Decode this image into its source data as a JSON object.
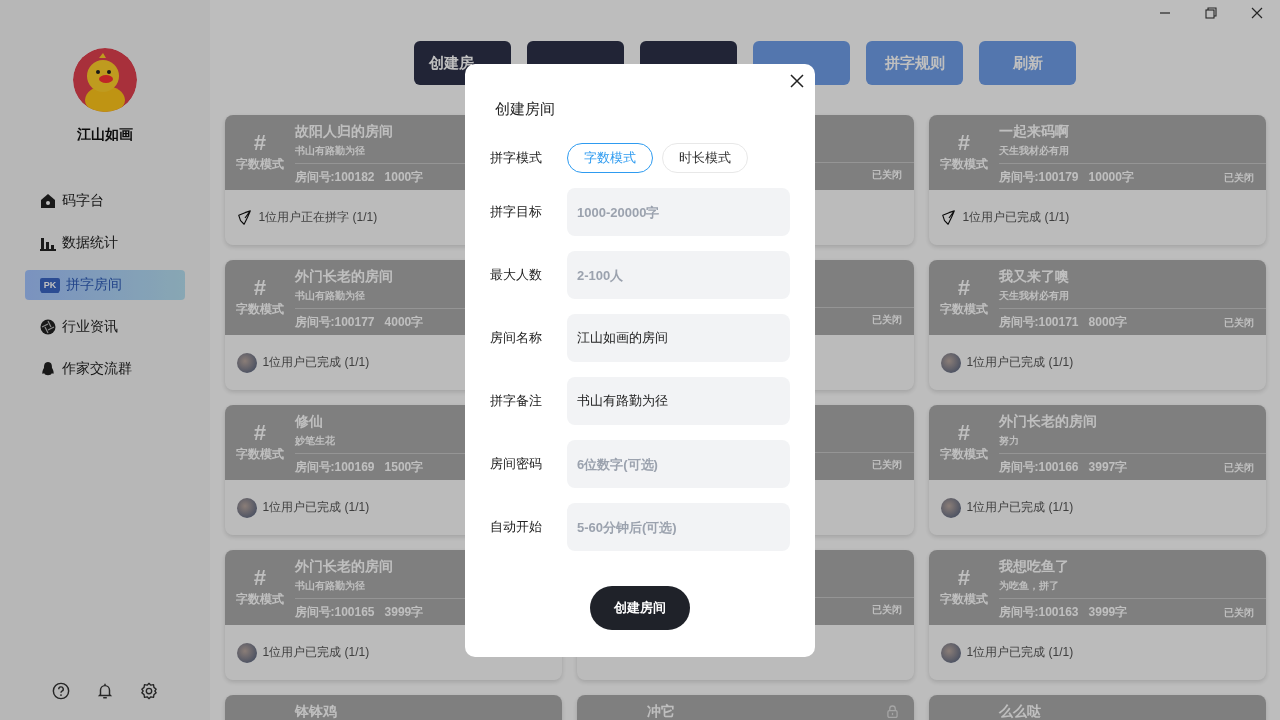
{
  "sidebar": {
    "user_name": "江山如画",
    "nav": [
      {
        "label": "码字台",
        "selected": false
      },
      {
        "label": "数据统计",
        "selected": false
      },
      {
        "label": "拼字房间",
        "selected": true,
        "badge": "PK"
      },
      {
        "label": "行业资讯",
        "selected": false
      },
      {
        "label": "作家交流群",
        "selected": false
      }
    ]
  },
  "toolbar": [
    {
      "label": "创建房",
      "kind": "dark"
    },
    {
      "kind": "dark"
    },
    {
      "kind": "dark"
    },
    {
      "kind": "light"
    },
    {
      "label": "拼字规则",
      "kind": "light"
    },
    {
      "label": "刷新",
      "kind": "light"
    }
  ],
  "rooms": [
    {
      "hash": "#",
      "mode": "字数模式",
      "title": "故阳人归的房间",
      "note": "书山有路勤为径",
      "room_no": "房间号:100182",
      "target": "1000字",
      "footer": {
        "kind": "writing",
        "text": "1位用户正在拼字 (1/1)"
      },
      "locked": false
    },
    {
      "status": "已关闭",
      "locked": false
    },
    {
      "hash": "#",
      "mode": "字数模式",
      "title": "一起来码啊",
      "note": "天生我材必有用",
      "room_no": "房间号:100179",
      "target": "10000字",
      "status": "已关闭",
      "footer": {
        "kind": "writing",
        "text": "1位用户已完成 (1/1)"
      },
      "locked": false
    },
    {
      "hash": "#",
      "mode": "字数模式",
      "title": "外门长老的房间",
      "note": "书山有路勤为径",
      "room_no": "房间号:100177",
      "target": "4000字",
      "footer": {
        "kind": "avatar",
        "text": "1位用户已完成 (1/1)"
      },
      "locked": false
    },
    {
      "status": "已关闭",
      "locked": false
    },
    {
      "hash": "#",
      "mode": "字数模式",
      "title": "我又来了噢",
      "note": "天生我材必有用",
      "room_no": "房间号:100171",
      "target": "8000字",
      "status": "已关闭",
      "footer": {
        "kind": "avatar",
        "text": "1位用户已完成 (1/1)"
      },
      "locked": false
    },
    {
      "hash": "#",
      "mode": "字数模式",
      "title": "修仙",
      "note": "妙笔生花",
      "room_no": "房间号:100169",
      "target": "1500字",
      "footer": {
        "kind": "avatar",
        "text": "1位用户已完成 (1/1)"
      },
      "locked": false
    },
    {
      "status": "已关闭",
      "locked": false
    },
    {
      "hash": "#",
      "mode": "字数模式",
      "title": "外门长老的房间",
      "note": "努力",
      "room_no": "房间号:100166",
      "target": "3997字",
      "status": "已关闭",
      "footer": {
        "kind": "avatar",
        "text": "1位用户已完成 (1/1)"
      },
      "locked": false
    },
    {
      "hash": "#",
      "mode": "字数模式",
      "title": "外门长老的房间",
      "note": "书山有路勤为径",
      "room_no": "房间号:100165",
      "target": "3999字",
      "footer": {
        "kind": "avatar",
        "text": "1位用户已完成 (1/1)"
      },
      "locked": false
    },
    {
      "status": "已关闭",
      "locked": false
    },
    {
      "hash": "#",
      "mode": "字数模式",
      "title": "我想吃鱼了",
      "note": "为吃鱼，拼了",
      "room_no": "房间号:100163",
      "target": "3999字",
      "status": "已关闭",
      "footer": {
        "kind": "avatar",
        "text": "1位用户已完成 (1/1)"
      },
      "locked": false
    },
    {
      "title": "钵钵鸡",
      "locked": false
    },
    {
      "title": "冲它",
      "locked": true
    },
    {
      "title": "么么哒",
      "locked": false
    }
  ],
  "dialog": {
    "title": "创建房间",
    "fields": [
      {
        "kind": "mode",
        "label": "拼字模式",
        "options": [
          {
            "label": "字数模式",
            "selected": true
          },
          {
            "label": "时长模式",
            "selected": false
          }
        ]
      },
      {
        "kind": "input",
        "label": "拼字目标",
        "placeholder": "1000-20000字"
      },
      {
        "kind": "input",
        "label": "最大人数",
        "placeholder": "2-100人"
      },
      {
        "kind": "input",
        "label": "房间名称",
        "value": "江山如画的房间"
      },
      {
        "kind": "input",
        "label": "拼字备注",
        "value": "书山有路勤为径"
      },
      {
        "kind": "input",
        "label": "房间密码",
        "placeholder": "6位数字(可选)"
      },
      {
        "kind": "input",
        "label": "自动开始",
        "placeholder": "5-60分钟后(可选)"
      }
    ],
    "submit": "创建房间"
  }
}
